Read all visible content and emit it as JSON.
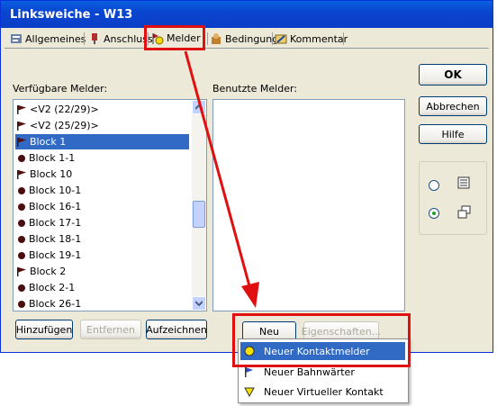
{
  "window": {
    "title": "Linksweiche - W13"
  },
  "tabs": [
    {
      "label": "Allgemeines",
      "icon": "settings-icon"
    },
    {
      "label": "Anschluss",
      "icon": "connector-icon"
    },
    {
      "label": "Melder",
      "icon": "detector-icon"
    },
    {
      "label": "Bedingung",
      "icon": "condition-icon"
    },
    {
      "label": "Kommentar",
      "icon": "comment-icon"
    }
  ],
  "available": {
    "label": "Verfügbare Melder:",
    "items": [
      {
        "text": "<V2 (22/29)>",
        "icon": "flag"
      },
      {
        "text": "<V2 (25/29)>",
        "icon": "flag"
      },
      {
        "text": "Block 1",
        "icon": "flag",
        "selected": true
      },
      {
        "text": "Block 1-1",
        "icon": "dot"
      },
      {
        "text": "Block 10",
        "icon": "flag"
      },
      {
        "text": "Block 10-1",
        "icon": "dot"
      },
      {
        "text": "Block 16-1",
        "icon": "dot"
      },
      {
        "text": "Block 17-1",
        "icon": "dot"
      },
      {
        "text": "Block 18-1",
        "icon": "dot"
      },
      {
        "text": "Block 19-1",
        "icon": "dot"
      },
      {
        "text": "Block 2",
        "icon": "flag"
      },
      {
        "text": "Block 2-1",
        "icon": "dot"
      },
      {
        "text": "Block 26-1",
        "icon": "dot"
      }
    ]
  },
  "used": {
    "label": "Benutzte Melder:"
  },
  "buttons": {
    "ok": "OK",
    "cancel": "Abbrechen",
    "help": "Hilfe",
    "add": "Hinzufügen",
    "remove": "Entfernen",
    "record": "Aufzeichnen",
    "new": "Neu",
    "properties": "Eigenschaften..."
  },
  "context_menu": [
    {
      "text": "Neuer Kontaktmelder",
      "icon": "yellow-circle-icon",
      "selected": true
    },
    {
      "text": "Neuer Bahnwärter",
      "icon": "flag-icon"
    },
    {
      "text": "Neuer Virtueller Kontakt",
      "icon": "triangle-icon"
    }
  ],
  "colors": {
    "accent": "#316ac5",
    "highlight": "#e01010",
    "titlebar": "#0a46d0"
  }
}
